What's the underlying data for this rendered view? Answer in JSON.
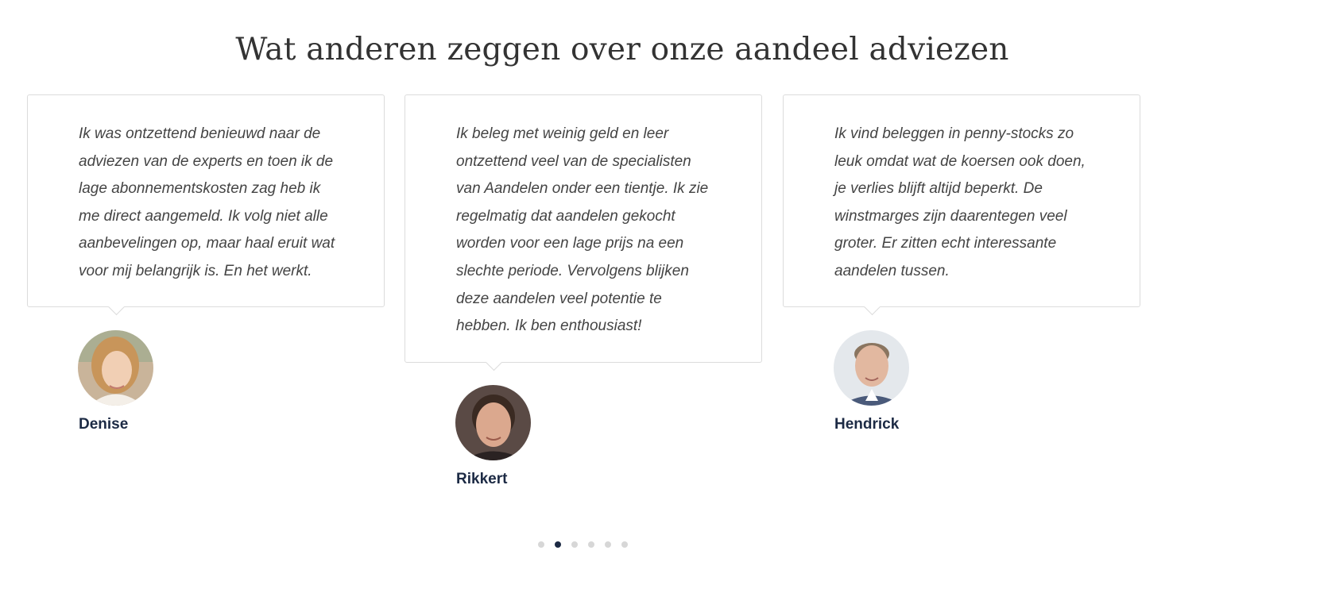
{
  "heading": "Wat anderen zeggen over onze aandeel adviezen",
  "testimonials": [
    {
      "quote": "Ik was ontzettend benieuwd naar de adviezen van de experts en toen ik de lage abonnementskosten zag heb ik me direct aangemeld. Ik volg niet alle aanbevelingen op, maar haal eruit wat voor mij belangrijk is. En het werkt.",
      "name": "Denise",
      "avatar_icon": "woman-portrait-icon"
    },
    {
      "quote": "Ik beleg met weinig geld en leer ontzettend veel van de specialisten van Aandelen onder een tientje. Ik zie regelmatig dat aandelen gekocht worden voor een lage prijs na een slechte periode. Vervolgens blijken deze aandelen veel potentie te hebben. Ik ben enthousiast!",
      "name": "Rikkert",
      "avatar_icon": "man-portrait-icon"
    },
    {
      "quote": "Ik vind beleggen in penny-stocks zo leuk omdat wat de koersen ook doen, je verlies blijft altijd beperkt. De winstmarges zijn daarentegen veel groter. Er zitten echt interessante aandelen tussen.",
      "name": "Hendrick",
      "avatar_icon": "man-portrait-icon"
    }
  ],
  "pagination": {
    "total": 6,
    "active": 2
  },
  "colors": {
    "accent": "#1c2a44",
    "text": "#444444",
    "border": "#dcdcdc",
    "dot_inactive": "#d7d7d7"
  }
}
